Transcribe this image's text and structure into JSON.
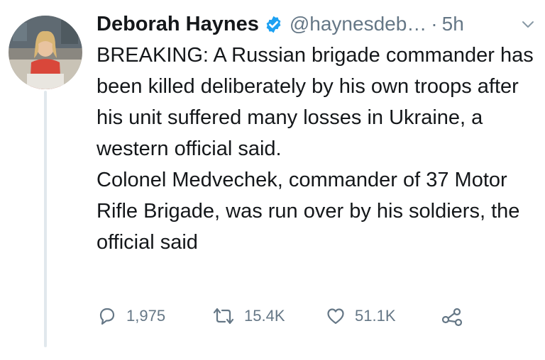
{
  "tweet": {
    "author": {
      "name": "Deborah Haynes",
      "handle": "@haynesdeb…",
      "verified": true
    },
    "separator": "·",
    "time": "5h",
    "text": [
      "BREAKING: A Russian brigade commander has been killed deliberately by his own troops after his unit suffered many losses in Ukraine, a western official said.",
      "Colonel Medvechek, commander of 37 Motor Rifle Brigade, was run over by his soldiers, the official said"
    ],
    "stats": {
      "replies": "1,975",
      "retweets": "15.4K",
      "likes": "51.1K"
    }
  },
  "icons": {
    "verified": "verified-badge-icon",
    "menu": "chevron-down-icon",
    "reply": "reply-icon",
    "retweet": "retweet-icon",
    "like": "heart-icon",
    "share": "share-icon"
  },
  "colors": {
    "text": "#14171a",
    "secondary": "#657786",
    "verified": "#1da1f2",
    "thread_line": "#e1e8ed"
  }
}
